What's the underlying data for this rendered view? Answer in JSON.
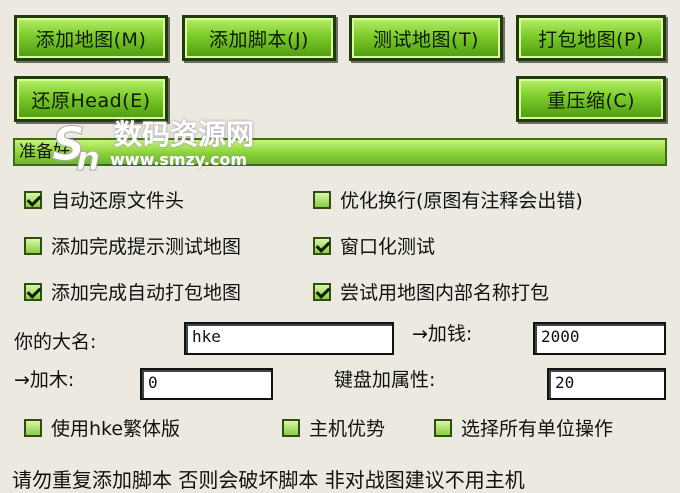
{
  "buttons": {
    "add_map": "添加地图(M)",
    "add_script": "添加脚本(J)",
    "test_map": "测试地图(T)",
    "pack_map": "打包地图(P)",
    "restore_head": "还原Head(E)",
    "recompress": "重压缩(C)"
  },
  "status": "准备好",
  "options": {
    "auto_restore_header": {
      "label": "自动还原文件头",
      "checked": true
    },
    "optimize_newline": {
      "label": "优化换行(原图有注释会出错)",
      "checked": false
    },
    "prompt_test_map": {
      "label": "添加完成提示测试地图",
      "checked": false
    },
    "windowed_test": {
      "label": "窗口化测试",
      "checked": true
    },
    "auto_pack_map": {
      "label": "添加完成自动打包地图",
      "checked": true
    },
    "internal_name_pack": {
      "label": "尝试用地图内部名称打包",
      "checked": true
    },
    "traditional_version": {
      "label": "使用hke繁体版",
      "checked": false
    },
    "host_advantage": {
      "label": "主机优势",
      "checked": false
    },
    "select_all_units": {
      "label": "选择所有单位操作",
      "checked": false
    }
  },
  "fields": {
    "name_label": "你的大名:",
    "name_value": "hke",
    "gold_label": "→加钱:",
    "gold_value": "2000",
    "wood_label": "→加木:",
    "wood_value": "0",
    "hotkey_label": "键盘加属性:",
    "hotkey_value": "20"
  },
  "notice": "请勿重复添加脚本 否则会破坏脚本 非对战图建议不用主机",
  "watermark": {
    "brand": "数码资源网",
    "url": "www.smzy.com"
  },
  "colors": {
    "button_green": "#7ccb2a",
    "background": "#ece9e0"
  }
}
